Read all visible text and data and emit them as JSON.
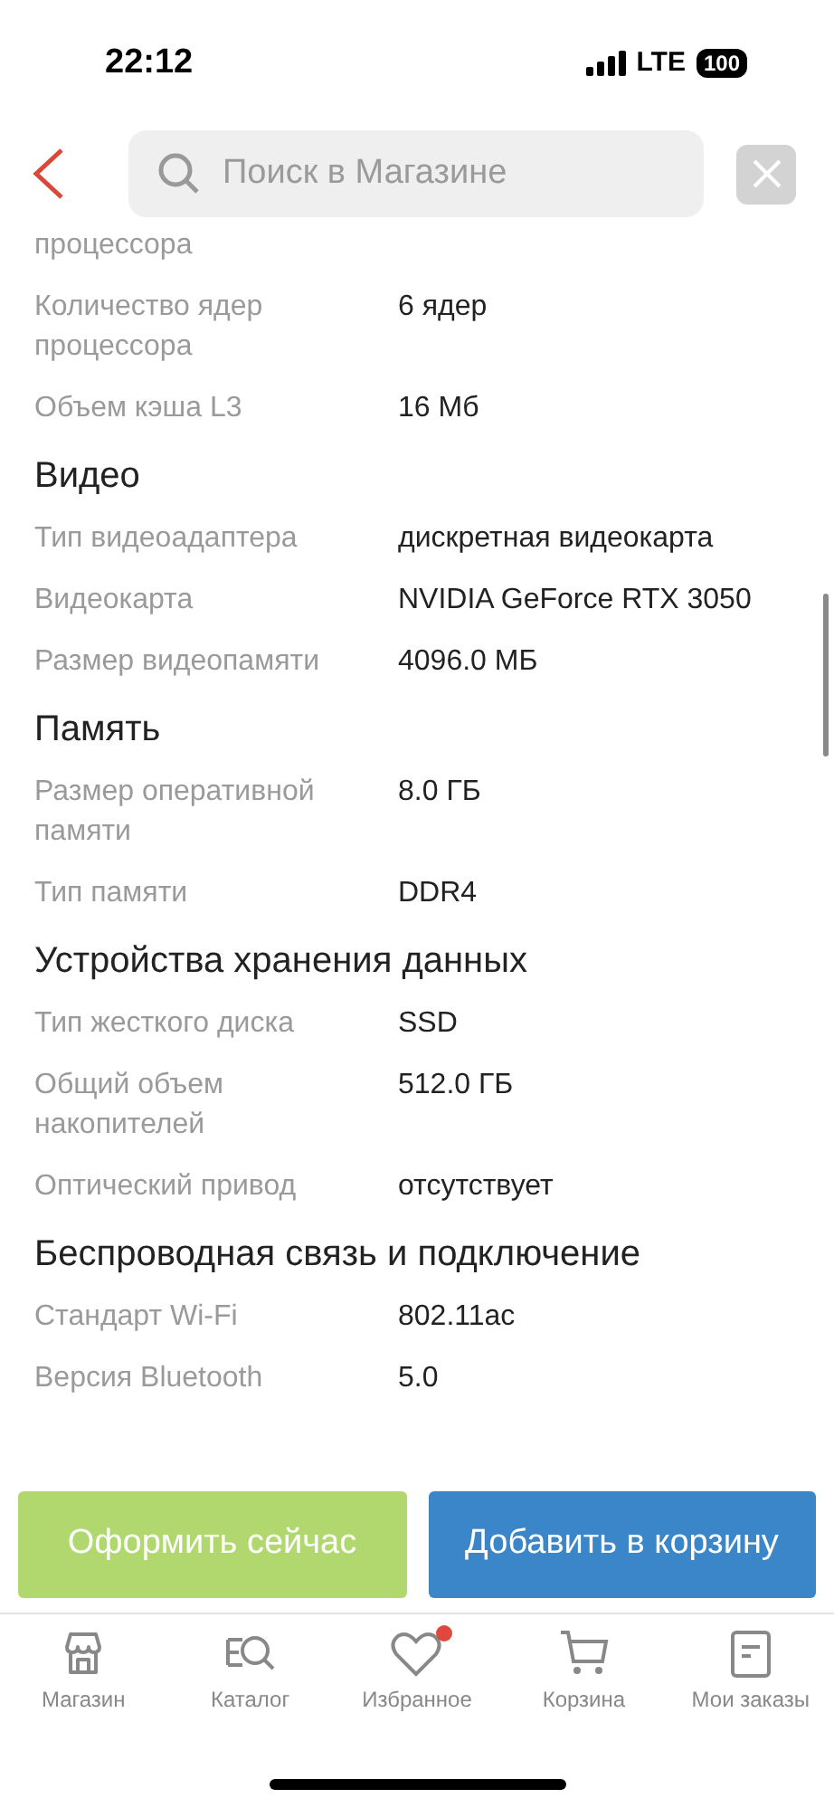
{
  "status_bar": {
    "time": "22:12",
    "network": "LTE",
    "battery": "100"
  },
  "search": {
    "placeholder": "Поиск в Магазине"
  },
  "sections": [
    {
      "rows": [
        {
          "label": "процессора"
        },
        {
          "label": "Количество ядер процессора",
          "value": "6 ядер"
        },
        {
          "label": "Объем кэша L3",
          "value": "16 Мб"
        }
      ]
    },
    {
      "heading": "Видео",
      "rows": [
        {
          "label": "Тип видеоадаптера",
          "value": "дискретная видеокарта"
        },
        {
          "label": "Видеокарта",
          "value": "NVIDIA GeForce RTX 3050"
        },
        {
          "label": "Размер видеопамяти",
          "value": "4096.0 МБ"
        }
      ]
    },
    {
      "heading": "Память",
      "rows": [
        {
          "label": "Размер оперативной памяти",
          "value": "8.0 ГБ"
        },
        {
          "label": "Тип памяти",
          "value": "DDR4"
        }
      ]
    },
    {
      "heading": "Устройства хранения данных",
      "rows": [
        {
          "label": "Тип жесткого диска",
          "value": "SSD"
        },
        {
          "label": "Общий объем накопителей",
          "value": "512.0 ГБ"
        },
        {
          "label": "Оптический привод",
          "value": "отсутствует"
        }
      ]
    },
    {
      "heading": "Беспроводная связь и подключение",
      "rows": [
        {
          "label": "Стандарт Wi-Fi",
          "value": "802.11ac"
        },
        {
          "label": "Версия Bluetooth",
          "value": "5.0"
        }
      ]
    }
  ],
  "actions": [
    "Оформить сейчас",
    "Добавить в корзину"
  ],
  "tab_bar": [
    {
      "kind": "store",
      "label": "Магазин",
      "badge": false
    },
    {
      "kind": "catalog",
      "label": "Каталог",
      "badge": false
    },
    {
      "kind": "favorites",
      "label": "Избранное",
      "badge": true
    },
    {
      "kind": "cart",
      "label": "Корзина",
      "badge": false
    },
    {
      "kind": "orders",
      "label": "Мои заказы",
      "badge": false
    }
  ]
}
